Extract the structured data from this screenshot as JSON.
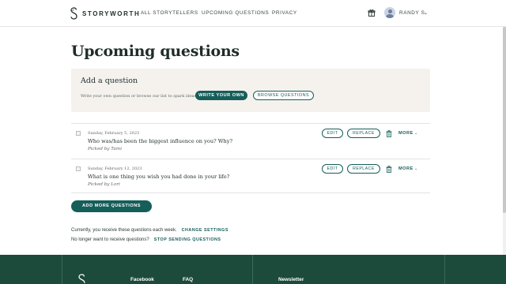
{
  "header": {
    "brand": "STORYWORTH",
    "nav": [
      "ALL STORYTELLERS",
      "UPCOMING QUESTIONS",
      "PRIVACY"
    ],
    "user_name": "RANDY S.",
    "user_chevron": "⌄",
    "icons": {
      "logo": "storyworth-logo-icon",
      "gift": "gift-icon",
      "avatar": "avatar-icon"
    }
  },
  "page": {
    "title": "Upcoming questions"
  },
  "add_question": {
    "title": "Add a question",
    "description": "Write your own question or browse our list to spark ideas",
    "write_label": "WRITE YOUR OWN",
    "browse_label": "BROWSE QUESTIONS"
  },
  "questions": [
    {
      "date": "Sunday, February 5, 2023",
      "text": "Who was/has been the biggest influence on you? Why?",
      "picked": "Picked by Tami",
      "edit": "EDIT",
      "replace": "REPLACE",
      "more": "MORE",
      "more_chevron": "⌄"
    },
    {
      "date": "Sunday, February 12, 2023",
      "text": "What is one thing you wish you had done in your life?",
      "picked": "Picked by Lori",
      "edit": "EDIT",
      "replace": "REPLACE",
      "more": "MORE",
      "more_chevron": "⌄"
    }
  ],
  "actions": {
    "add_more": "ADD MORE QUESTIONS"
  },
  "info": {
    "line1": "Currently, you receive these questions each week.",
    "line1_link": "CHANGE SETTINGS",
    "line2": "No longer want to receive questions?",
    "line2_link": "STOP SENDING QUESTIONS"
  },
  "footer": {
    "links": [
      "Facebook",
      "FAQ",
      "Newsletter"
    ]
  },
  "colors": {
    "accent": "#165e5a",
    "footer_bg": "#1c4a3b",
    "panel_bg": "#f5f2ee"
  }
}
